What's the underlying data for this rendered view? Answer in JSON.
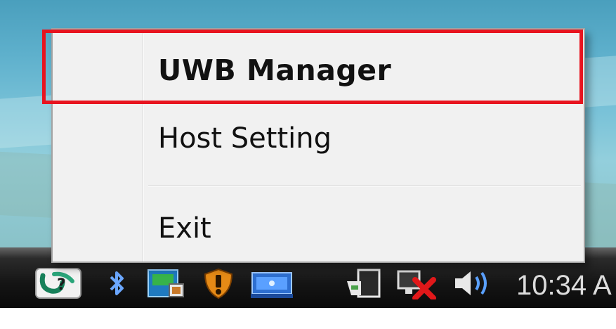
{
  "context_menu": {
    "items": [
      {
        "label": "UWB Manager",
        "default": true
      },
      {
        "label": "Host Setting"
      },
      {
        "label": "Exit"
      }
    ]
  },
  "taskbar": {
    "tray_icons": [
      "uwb-tray-icon",
      "bluetooth-icon",
      "app-icon",
      "shield-icon",
      "network-adapter-icon",
      "safely-remove-hardware-icon",
      "network-disconnected-icon",
      "volume-icon"
    ],
    "clock": "10:34 A"
  },
  "annotation": {
    "highlight_color": "#e8141f"
  }
}
